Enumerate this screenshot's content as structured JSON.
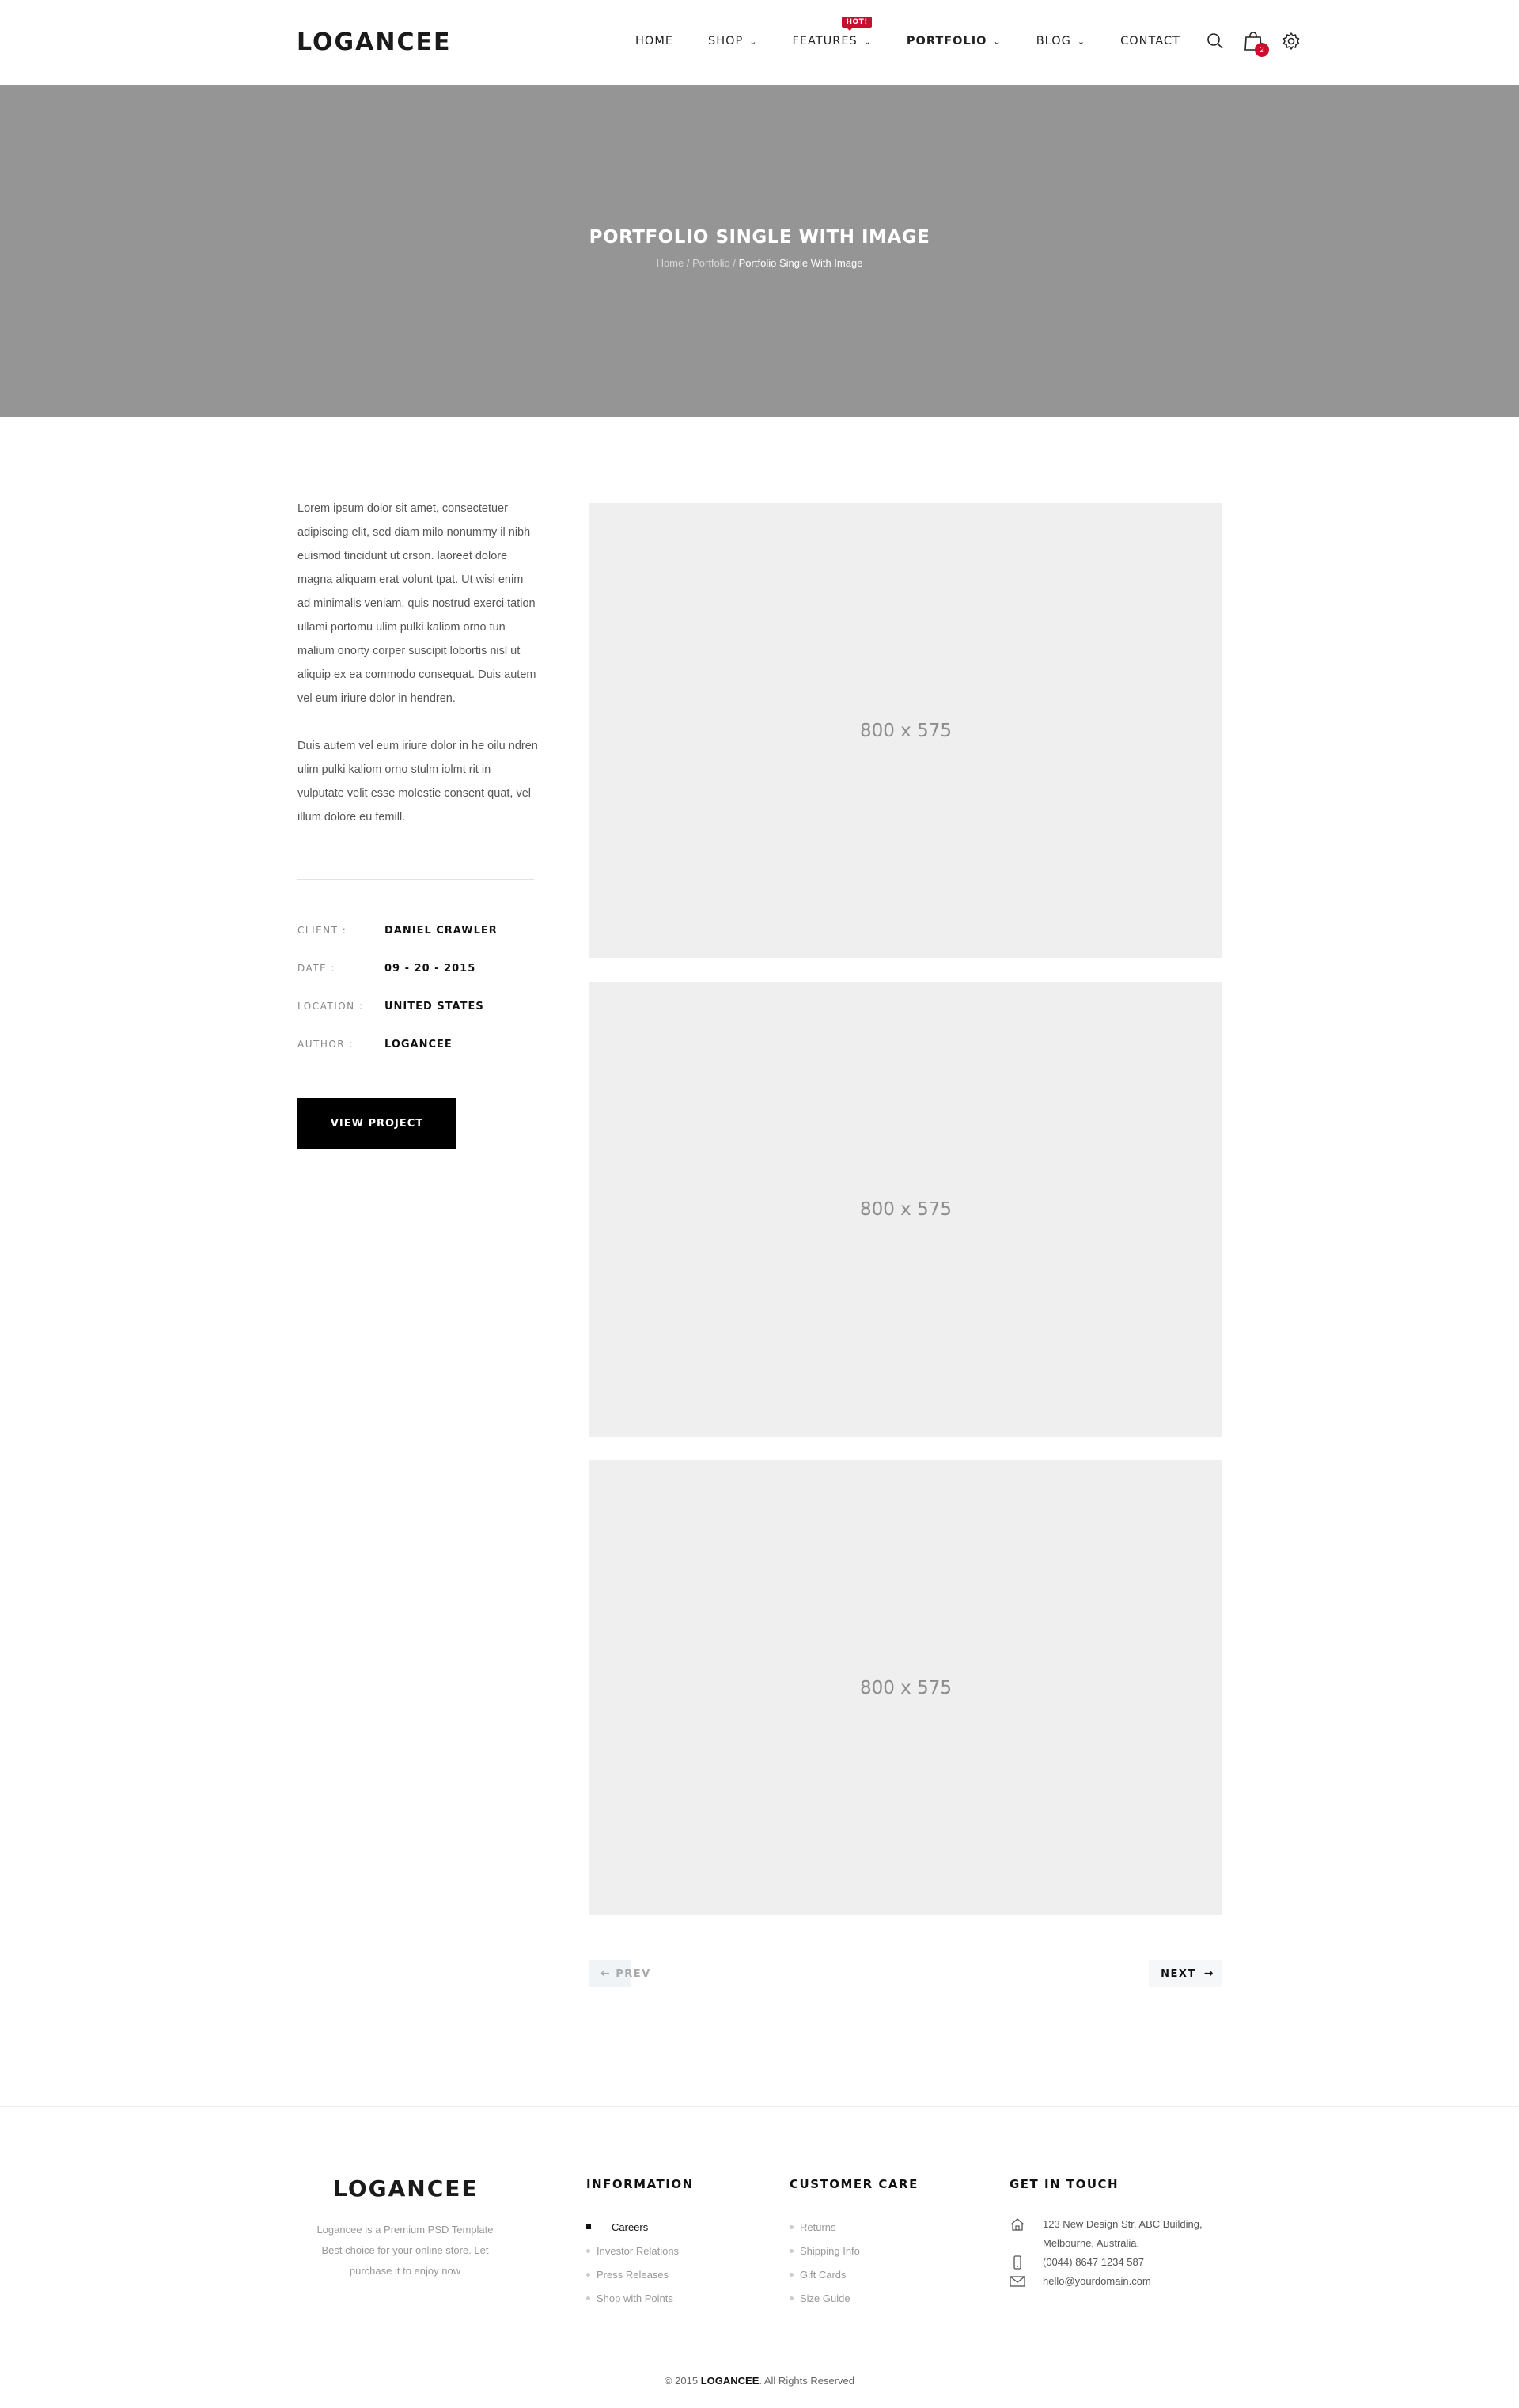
{
  "header": {
    "logo": "LOGANCEE",
    "nav": [
      {
        "label": "HOME"
      },
      {
        "label": "SHOP"
      },
      {
        "label": "FEATURES",
        "badge": "HOT!"
      },
      {
        "label": "PORTFOLIO"
      },
      {
        "label": "BLOG"
      },
      {
        "label": "CONTACT"
      }
    ],
    "cart_count": "2",
    "icons": [
      "search-icon",
      "shopping-bag-icon",
      "gear-icon"
    ]
  },
  "hero": {
    "title": "PORTFOLIO SINGLE WITH IMAGE",
    "breadcrumb": {
      "home": "Home",
      "sep": " / ",
      "portfolio": "Portfolio",
      "current": "Portfolio Single With Image"
    }
  },
  "project": {
    "paragraph1": "Lorem ipsum dolor sit amet, consectetuer adipiscing elit, sed diam milo nonummy il nibh euismod tincidunt ut crson. laoreet dolore magna aliquam erat volunt tpat. Ut wisi enim ad minimalis veniam, quis nostrud exerci tation ullami portomu ulim pulki kaliom orno tun malium onorty corper suscipit lobortis nisl ut aliquip ex ea commodo consequat. Duis autem vel eum iriure dolor in hendren.",
    "paragraph2": "Duis autem vel eum iriure dolor in he oilu ndren ulim pulki kaliom orno stulm iolmt rit in vulputate velit esse molestie consent quat, vel illum dolore eu femill.",
    "meta": [
      {
        "label": "CLIENT :",
        "value": "DANIEL CRAWLER"
      },
      {
        "label": "DATE :",
        "value": "09 - 20 - 2015"
      },
      {
        "label": "LOCATION :",
        "value": "UNITED STATES"
      },
      {
        "label": "AUTHOR :",
        "value": "LOGANCEE"
      }
    ],
    "button": "VIEW PROJECT",
    "images": [
      "800 x 575",
      "800 x 575",
      "800 x 575"
    ],
    "prev": "PREV",
    "next": "NEXT"
  },
  "footer": {
    "logo": "LOGANCEE",
    "about": "Logancee is a Premium PSD Template Best choice for your online store. Let purchase it to enjoy now",
    "information": {
      "title": "INFORMATION",
      "items": [
        "Careers",
        "Investor Relations",
        "Press Releases",
        "Shop with Points"
      ]
    },
    "customer_care": {
      "title": "CUSTOMER CARE",
      "items": [
        "Returns",
        "Shipping Info",
        "Gift Cards",
        "Size Guide"
      ]
    },
    "contact": {
      "title": "GET IN TOUCH",
      "address_line1": "123 New Design Str, ABC Building,",
      "address_line2": "Melbourne, Australia.",
      "phone": "(0044) 8647 1234 587",
      "email": "hello@yourdomain.com"
    },
    "copyright_prefix": "© 2015 ",
    "copyright_brand": "LOGANCEE",
    "copyright_suffix": ". All Rights Reserved"
  }
}
